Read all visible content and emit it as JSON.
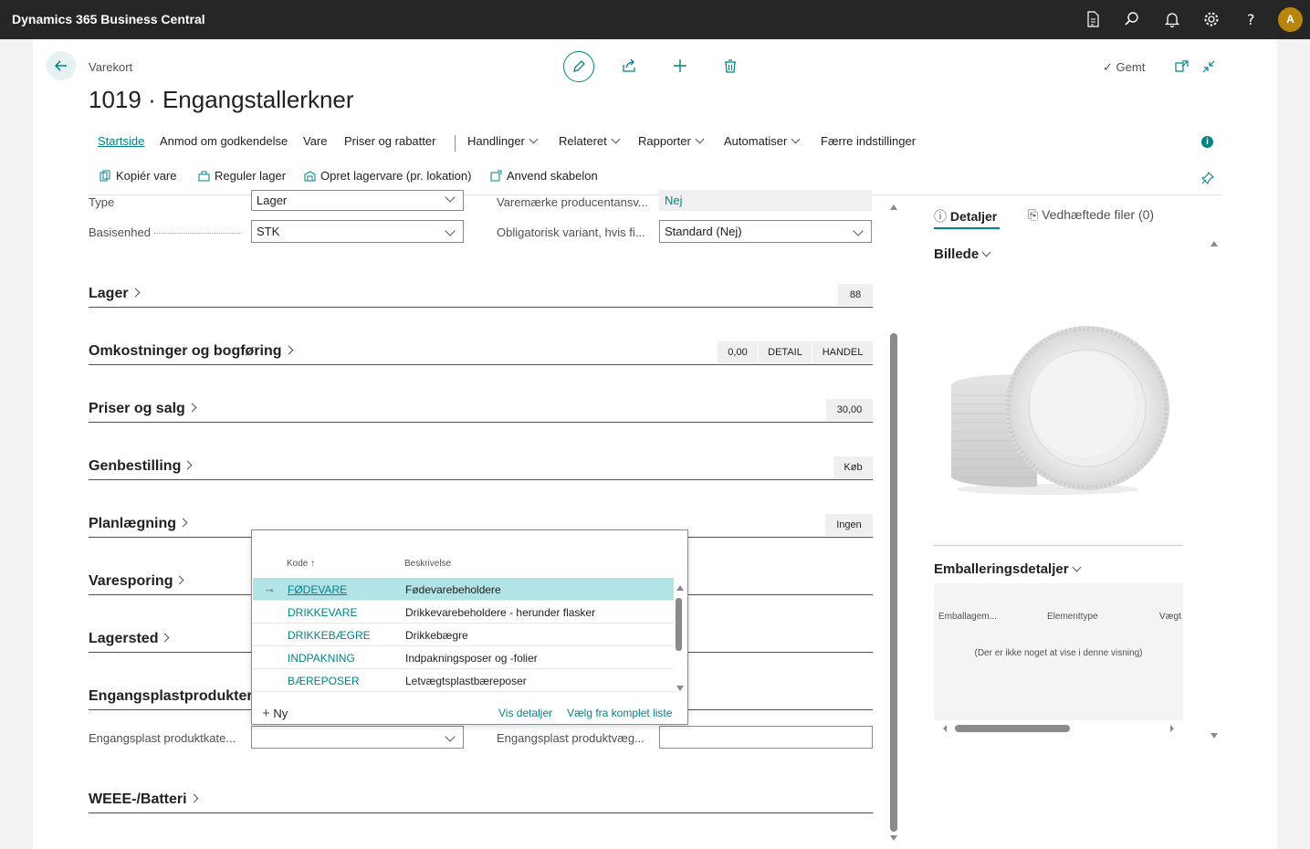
{
  "app": {
    "title": "Dynamics 365 Business Central",
    "avatar_initial": "A"
  },
  "header": {
    "breadcrumb": "Varekort",
    "title": "1019 · Engangstallerkner",
    "saved_label": "Gemt"
  },
  "actions": {
    "tabs": [
      {
        "label": "Startside"
      },
      {
        "label": "Anmod om godkendelse"
      },
      {
        "label": "Vare"
      },
      {
        "label": "Priser og rabatter"
      },
      {
        "label": "Handlinger"
      },
      {
        "label": "Relateret"
      },
      {
        "label": "Rapporter"
      },
      {
        "label": "Automatiser"
      },
      {
        "label": "Færre indstillinger"
      }
    ],
    "subactions": [
      {
        "label": "Kopiér vare"
      },
      {
        "label": "Reguler lager"
      },
      {
        "label": "Opret lagervare (pr. lokation)"
      },
      {
        "label": "Anvend skabelon"
      }
    ]
  },
  "form": {
    "type_label": "Type",
    "type_value": "Lager",
    "base_unit_label": "Basisenhed",
    "base_unit_value": "STK",
    "brand_label": "Varemærke producentansv...",
    "brand_value": "Nej",
    "mandatory_variant_label": "Obligatorisk variant, hvis fi...",
    "mandatory_variant_value": "Standard (Nej)",
    "plastic_category_label": "Engangsplast produktkate...",
    "plastic_category_value": "",
    "plastic_weight_label": "Engangsplast produktvæg...",
    "plastic_weight_value": ""
  },
  "sections": {
    "lager": {
      "title": "Lager",
      "badge": "88"
    },
    "omkostninger": {
      "title": "Omkostninger og bogføring",
      "badges": [
        "0,00",
        "DETAIL",
        "HANDEL"
      ]
    },
    "priser": {
      "title": "Priser og salg",
      "badge": "30,00"
    },
    "genbestilling": {
      "title": "Genbestilling",
      "badge": "Køb"
    },
    "planlaegning": {
      "title": "Planlægning",
      "badge": "Ingen"
    },
    "varesporing": {
      "title": "Varesporing"
    },
    "lagersted": {
      "title": "Lagersted"
    },
    "engangsplast": {
      "title": "Engangsplastprodukter"
    },
    "weee": {
      "title": "WEEE-/Batteri"
    }
  },
  "dropdown": {
    "col_code": "Kode ↑",
    "col_desc": "Beskrivelse",
    "rows": [
      {
        "code": "FØDEVARE",
        "desc": "Fødevarebeholdere"
      },
      {
        "code": "DRIKKEVARE",
        "desc": "Drikkevarebeholdere - herunder flasker"
      },
      {
        "code": "DRIKKEBÆGRE",
        "desc": "Drikkebægre"
      },
      {
        "code": "INDPAKNING",
        "desc": "Indpakningsposer og -folier"
      },
      {
        "code": "BÆREPOSER",
        "desc": "Letvægtsplastbæreposer"
      }
    ],
    "new_label": "Ny",
    "details_label": "Vis detaljer",
    "full_list_label": "Vælg fra komplet liste"
  },
  "factbox": {
    "tab_details": "Detaljer",
    "tab_attachments": "Vedhæftede filer (0)",
    "picture_title": "Billede",
    "packaging_title": "Emballeringsdetaljer",
    "col1": "Emballagem...",
    "col2": "Elementtype",
    "col3": "Vægt",
    "empty_text": "(Der er ikke noget at vise i denne visning)"
  },
  "colors": {
    "accent": "#008489",
    "topbar": "#262626",
    "selected_row": "#b2e3e6"
  }
}
